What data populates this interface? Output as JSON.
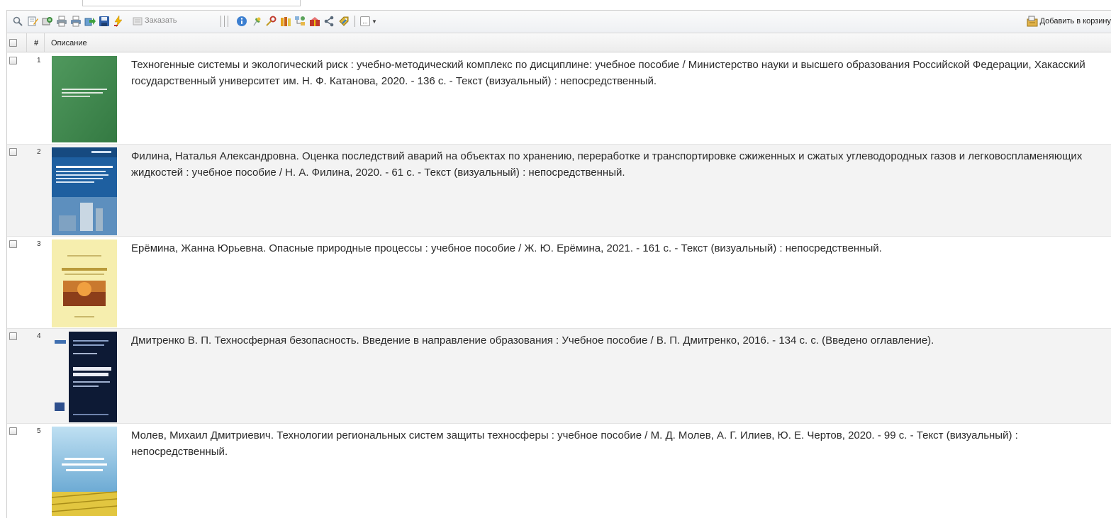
{
  "toolbar": {
    "order_label": "Заказать",
    "add_to_cart_label": "Добавить в корзину",
    "more_label": "..."
  },
  "table": {
    "header": {
      "num": "#",
      "description": "Описание"
    },
    "rows": [
      {
        "num": "1",
        "description": "Техногенные системы и экологический риск : учебно-методический комплекс по дисциплине: учебное пособие / Министерство науки и высшего образования Российской Федерации, Хакасский государственный университет им. Н. Ф. Катанова, 2020. - 136 с. - Текст (визуальный) : непосредственный."
      },
      {
        "num": "2",
        "description": "Филина, Наталья Александровна. Оценка последствий аварий на объектах по хранению, переработке и транспортировке сжиженных и сжатых углеводородных газов и легковоспламеняющих жидкостей : учебное пособие / Н. А. Филина, 2020. - 61 с. - Текст (визуальный) : непосредственный."
      },
      {
        "num": "3",
        "description": "Ерёмина, Жанна Юрьевна. Опасные природные процессы : учебное пособие / Ж. Ю. Ерёмина, 2021. - 161 с. - Текст (визуальный) : непосредственный."
      },
      {
        "num": "4",
        "description": "Дмитренко В. П. Техносферная безопасность. Введение в направление образования : Учебное пособие / В. П. Дмитренко, 2016. - 134 с. с. (Введено оглавление)."
      },
      {
        "num": "5",
        "description": "Молев, Михаил Дмитриевич. Технологии региональных систем защиты техносферы : учебное пособие / М. Д. Молев, А. Г. Илиев, Ю. Е. Чертов, 2020. - 99 с. - Текст (визуальный) : непосредственный."
      }
    ]
  },
  "colors": {
    "cover1": "#3f8a4e",
    "cover2": "#1e5fa0",
    "cover3": "#f6eeae",
    "cover4": "#0d1a35",
    "cover5": "#7fb9dd"
  }
}
